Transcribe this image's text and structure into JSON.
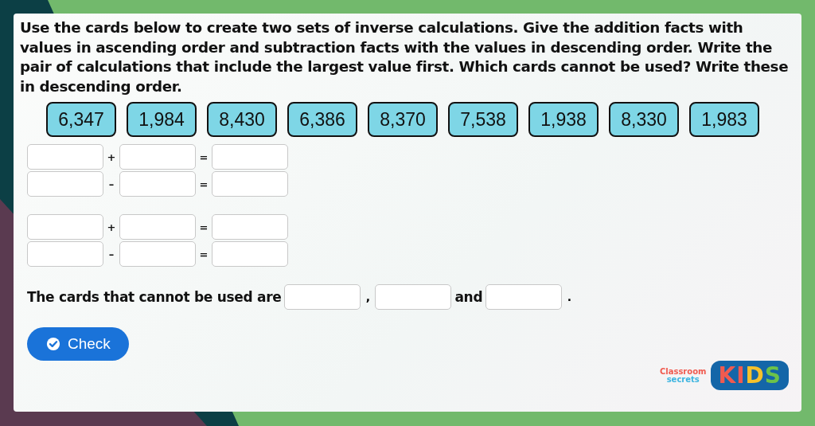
{
  "question": "Use the cards below to create two sets of inverse calculations. Give the addition facts with values in ascending order and subtraction facts with the values in descending order. Write the pair of calculations that include the largest value first. Which cards cannot be used? Write these in descending order.",
  "cards": [
    "6,347",
    "1,984",
    "8,430",
    "6,386",
    "8,370",
    "7,538",
    "1,938",
    "8,330",
    "1,983"
  ],
  "equation_sets": [
    [
      {
        "operator": "+",
        "equals": "="
      },
      {
        "operator": "–",
        "equals": "="
      }
    ],
    [
      {
        "operator": "+",
        "equals": "="
      },
      {
        "operator": "–",
        "equals": "="
      }
    ]
  ],
  "answer": {
    "prompt": "The cards that cannot be used are",
    "separator": ",",
    "conjunction": "and",
    "end": "."
  },
  "check_button": {
    "label": "Check"
  },
  "logo": {
    "line_1": "Classroom",
    "line_2": "secrets",
    "badge": "KIDS"
  }
}
